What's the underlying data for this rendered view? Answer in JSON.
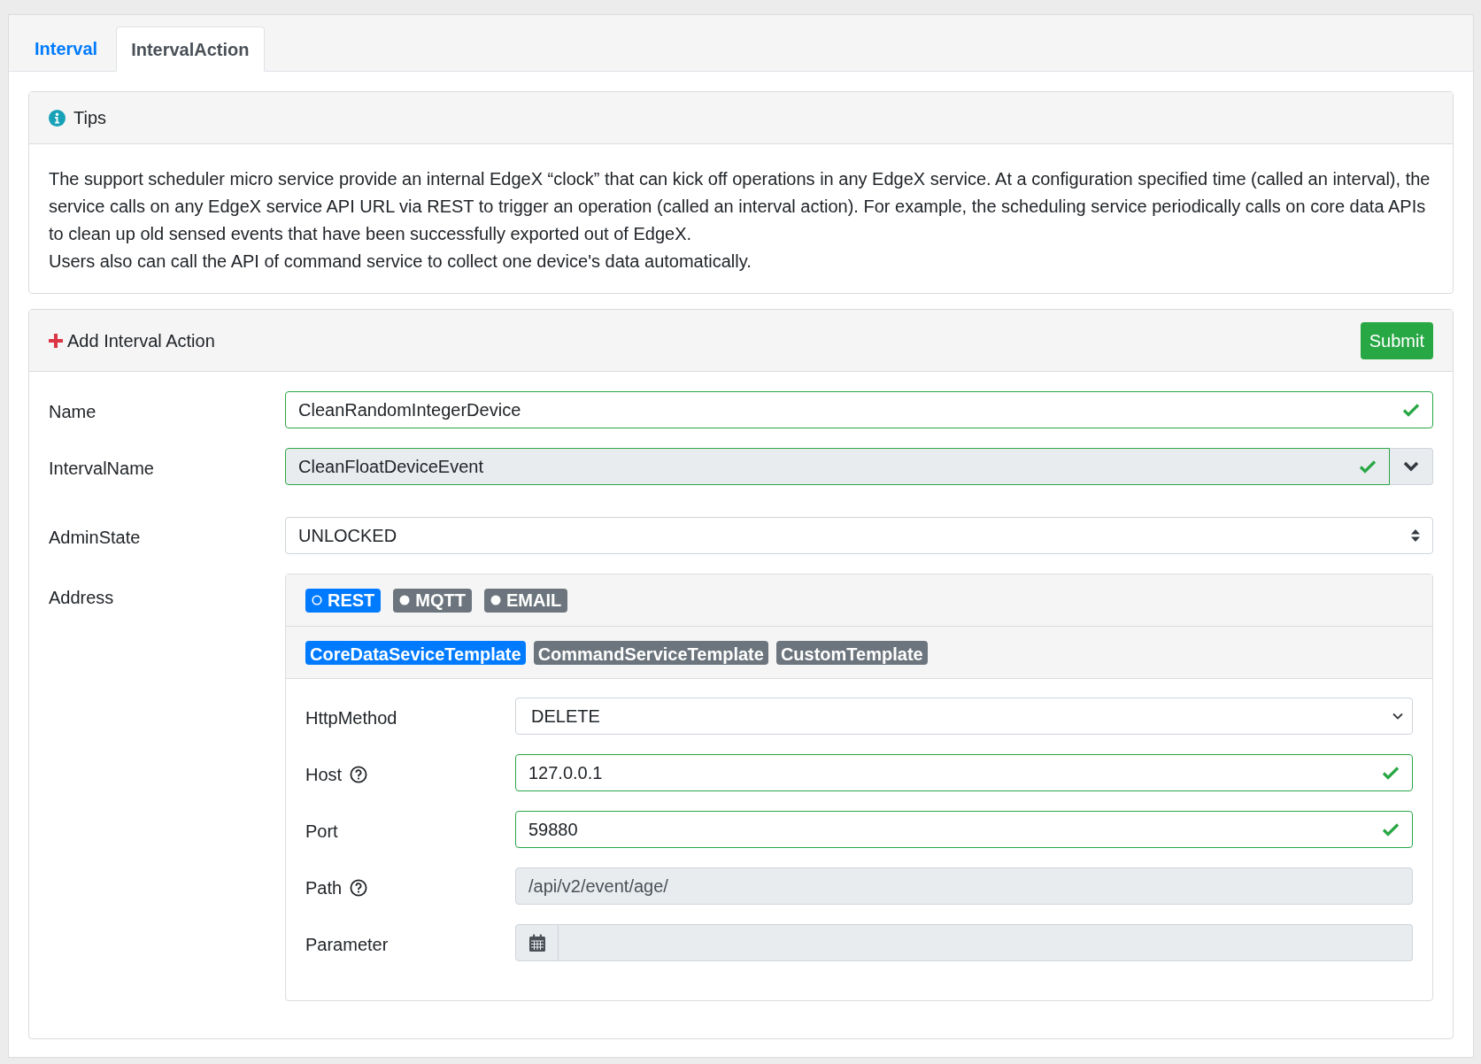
{
  "tabs": [
    {
      "label": "Interval",
      "selected": false
    },
    {
      "label": "IntervalAction",
      "selected": true
    }
  ],
  "tips": {
    "title": "Tips",
    "paragraphs": [
      "The support scheduler micro service provide an internal EdgeX “clock” that can kick off operations in any EdgeX service. At a configuration specified time (called an interval), the service calls on any EdgeX service API URL via REST to trigger an operation (called an interval action). For example, the scheduling service periodically calls on core data APIs to clean up old sensed events that have been successfully exported out of EdgeX.",
      "Users also can call the API of command service to collect one device's data automatically."
    ]
  },
  "add_form": {
    "title": "Add Interval Action",
    "submit": "Submit",
    "fields": [
      {
        "kind": "text",
        "label": "Name",
        "value": "CleanRandomIntegerDevice",
        "valid": true
      },
      {
        "kind": "combo",
        "label": "IntervalName",
        "value": "CleanFloatDeviceEvent",
        "valid": true
      },
      {
        "kind": "select",
        "label": "AdminState",
        "value": "UNLOCKED"
      }
    ],
    "address": {
      "label": "Address",
      "protocols": [
        {
          "label": "REST",
          "selected": true
        },
        {
          "label": "MQTT",
          "selected": false
        },
        {
          "label": "EMAIL",
          "selected": false
        }
      ],
      "templates": [
        {
          "label": "CoreDataSeviceTemplate",
          "selected": true
        },
        {
          "label": "CommandServiceTemplate",
          "selected": false
        },
        {
          "label": "CustomTemplate",
          "selected": false
        }
      ],
      "fields": [
        {
          "kind": "dropdown",
          "label": "HttpMethod",
          "value": "DELETE"
        },
        {
          "kind": "text",
          "label": "Host",
          "help": true,
          "value": "127.0.0.1",
          "valid": true
        },
        {
          "kind": "text",
          "label": "Port",
          "value": "59880",
          "valid": true
        },
        {
          "kind": "readonly",
          "label": "Path",
          "help": true,
          "value": "/api/v2/event/age/"
        },
        {
          "kind": "date",
          "label": "Parameter"
        }
      ]
    }
  }
}
